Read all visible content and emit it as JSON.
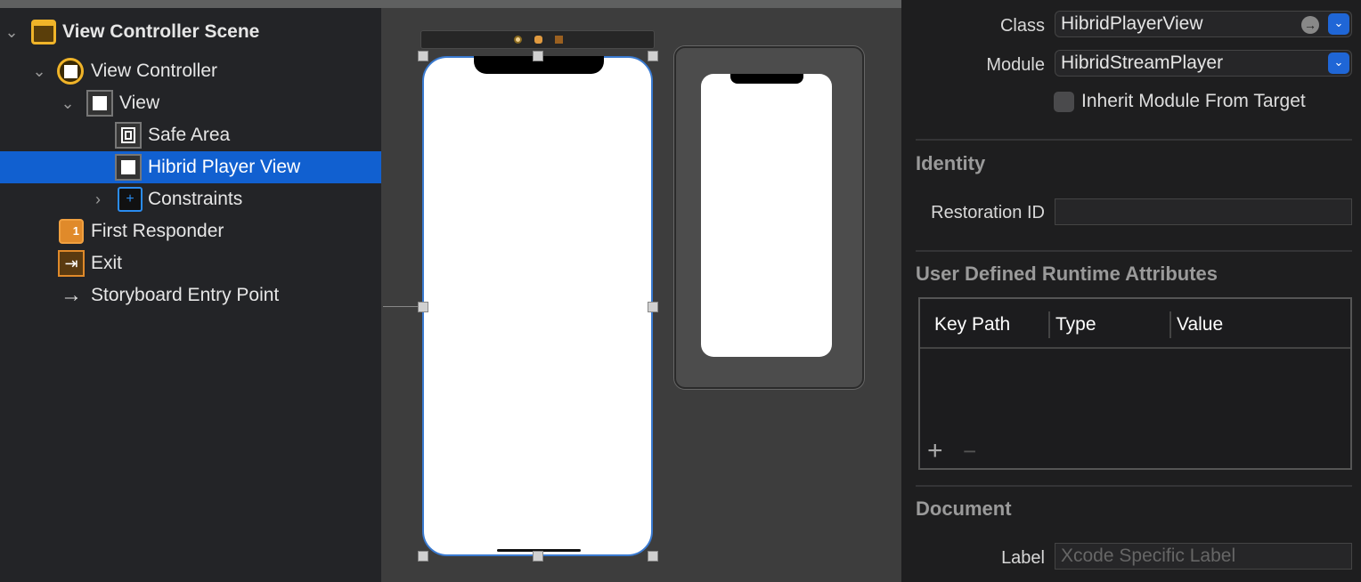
{
  "outline": {
    "items": [
      {
        "label": "View Controller Scene",
        "icon": "scene-icon",
        "expanded": true
      },
      {
        "label": "View Controller",
        "icon": "view-controller-icon",
        "expanded": true
      },
      {
        "label": "View",
        "icon": "view-icon",
        "expanded": true
      },
      {
        "label": "Safe Area",
        "icon": "safe-area-icon"
      },
      {
        "label": "Hibrid Player View",
        "icon": "view-icon",
        "selected": true
      },
      {
        "label": "Constraints",
        "icon": "constraints-icon",
        "expanded": false
      },
      {
        "label": "First Responder",
        "icon": "first-responder-icon"
      },
      {
        "label": "Exit",
        "icon": "exit-icon"
      },
      {
        "label": "Storyboard Entry Point",
        "icon": "arrow-right-icon"
      }
    ],
    "selected_color": "#1160d0"
  },
  "inspector": {
    "class_label": "Class",
    "class_value": "HibridPlayerView",
    "module_label": "Module",
    "module_value": "HibridStreamPlayer",
    "inherit_label": "Inherit Module From Target",
    "inherit_checked": false,
    "identity_title": "Identity",
    "restoration_label": "Restoration ID",
    "restoration_value": "",
    "runtime_title": "User Defined Runtime Attributes",
    "columns": [
      "Key Path",
      "Type",
      "Value"
    ],
    "add_label": "+",
    "remove_label": "−",
    "document_title": "Document",
    "doc_label": "Label",
    "doc_placeholder": "Xcode Specific Label"
  }
}
